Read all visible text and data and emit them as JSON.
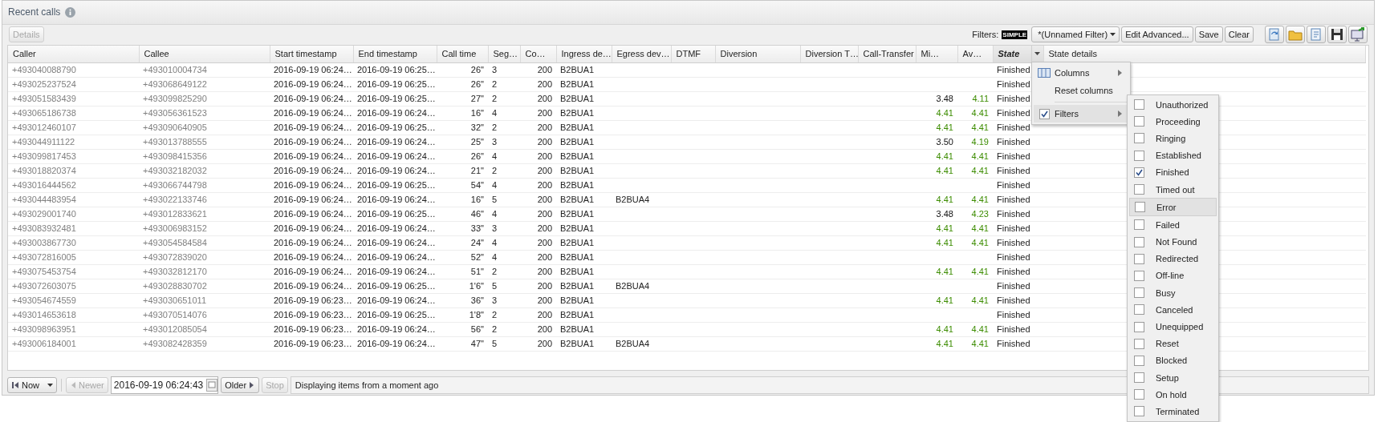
{
  "panel": {
    "title": "Recent calls"
  },
  "toolbar": {
    "details_button": {
      "label": "Details",
      "disabled": true
    },
    "filters_label": "Filters:",
    "mode_badge": "SIMPLE",
    "filter_select": "*(Unnamed Filter)",
    "buttons": [
      "Edit Advanced...",
      "Save",
      "Clear"
    ]
  },
  "table": {
    "columns": [
      {
        "label": "Caller",
        "filtered": false,
        "menu_open": false
      },
      {
        "label": "Callee",
        "filtered": false,
        "menu_open": false
      },
      {
        "label": "Start timestamp",
        "filtered": false,
        "menu_open": false
      },
      {
        "label": "End timestamp",
        "filtered": false,
        "menu_open": false
      },
      {
        "label": "Call time",
        "filtered": false,
        "menu_open": false
      },
      {
        "label": "Seg…",
        "filtered": false,
        "menu_open": false
      },
      {
        "label": "Co…",
        "filtered": false,
        "menu_open": false
      },
      {
        "label": "Ingress de…",
        "filtered": false,
        "menu_open": false
      },
      {
        "label": "Egress dev…",
        "filtered": false,
        "menu_open": false
      },
      {
        "label": "DTMF",
        "filtered": false,
        "menu_open": false
      },
      {
        "label": "Diversion",
        "filtered": false,
        "menu_open": false
      },
      {
        "label": "Diversion T…",
        "filtered": false,
        "menu_open": false
      },
      {
        "label": "Call-Transfer",
        "filtered": false,
        "menu_open": false
      },
      {
        "label": "Mi…",
        "filtered": false,
        "menu_open": false
      },
      {
        "label": "Av…",
        "filtered": false,
        "menu_open": false
      },
      {
        "label": "State",
        "filtered": true,
        "menu_open": true
      },
      {
        "label": "State details",
        "filtered": false,
        "menu_open": false
      }
    ],
    "rows": [
      {
        "caller": "+493040088790",
        "callee": "+493010004734",
        "start": "2016-09-19 06:24…",
        "end": "2016-09-19 06:25…",
        "call_time": "26\"",
        "segments": "3",
        "code": "200",
        "ingress": "B2BUA1",
        "state": "Finished"
      },
      {
        "caller": "+493025237524",
        "callee": "+493068649122",
        "start": "2016-09-19 06:24…",
        "end": "2016-09-19 06:25…",
        "call_time": "26\"",
        "segments": "2",
        "code": "200",
        "ingress": "B2BUA1",
        "state": "Finished"
      },
      {
        "caller": "+493051583439",
        "callee": "+493099825290",
        "start": "2016-09-19 06:24…",
        "end": "2016-09-19 06:25…",
        "call_time": "27\"",
        "segments": "2",
        "code": "200",
        "ingress": "B2BUA1",
        "mos_min": {
          "text": "3.48",
          "good": false
        },
        "mos_avg": {
          "text": "4.11",
          "good": true
        },
        "state": "Finished"
      },
      {
        "caller": "+493065186738",
        "callee": "+493056361523",
        "start": "2016-09-19 06:24…",
        "end": "2016-09-19 06:24…",
        "call_time": "16\"",
        "segments": "4",
        "code": "200",
        "ingress": "B2BUA1",
        "mos_min": {
          "text": "4.41",
          "good": true
        },
        "mos_avg": {
          "text": "4.41",
          "good": true
        },
        "state": "Finished"
      },
      {
        "caller": "+493012460107",
        "callee": "+493090640905",
        "start": "2016-09-19 06:24…",
        "end": "2016-09-19 06:25…",
        "call_time": "32\"",
        "segments": "2",
        "code": "200",
        "ingress": "B2BUA1",
        "mos_min": {
          "text": "4.41",
          "good": true
        },
        "mos_avg": {
          "text": "4.41",
          "good": true
        },
        "state": "Finished"
      },
      {
        "caller": "+493044911122",
        "callee": "+493013788555",
        "start": "2016-09-19 06:24…",
        "end": "2016-09-19 06:24…",
        "call_time": "25\"",
        "segments": "3",
        "code": "200",
        "ingress": "B2BUA1",
        "mos_min": {
          "text": "3.50",
          "good": false
        },
        "mos_avg": {
          "text": "4.19",
          "good": true
        },
        "state": "Finished"
      },
      {
        "caller": "+493099817453",
        "callee": "+493098415356",
        "start": "2016-09-19 06:24…",
        "end": "2016-09-19 06:24…",
        "call_time": "26\"",
        "segments": "4",
        "code": "200",
        "ingress": "B2BUA1",
        "mos_min": {
          "text": "4.41",
          "good": true
        },
        "mos_avg": {
          "text": "4.41",
          "good": true
        },
        "state": "Finished"
      },
      {
        "caller": "+493018820374",
        "callee": "+493032182032",
        "start": "2016-09-19 06:24…",
        "end": "2016-09-19 06:24…",
        "call_time": "21\"",
        "segments": "2",
        "code": "200",
        "ingress": "B2BUA1",
        "mos_min": {
          "text": "4.41",
          "good": true
        },
        "mos_avg": {
          "text": "4.41",
          "good": true
        },
        "state": "Finished"
      },
      {
        "caller": "+493016444562",
        "callee": "+493066744798",
        "start": "2016-09-19 06:24…",
        "end": "2016-09-19 06:25…",
        "call_time": "54\"",
        "segments": "4",
        "code": "200",
        "ingress": "B2BUA1",
        "state": "Finished"
      },
      {
        "caller": "+493044483954",
        "callee": "+493022133746",
        "start": "2016-09-19 06:24…",
        "end": "2016-09-19 06:24…",
        "call_time": "16\"",
        "segments": "5",
        "code": "200",
        "ingress": "B2BUA1",
        "egress": "B2BUA4",
        "mos_min": {
          "text": "4.41",
          "good": true
        },
        "mos_avg": {
          "text": "4.41",
          "good": true
        },
        "state": "Finished"
      },
      {
        "caller": "+493029001740",
        "callee": "+493012833621",
        "start": "2016-09-19 06:24…",
        "end": "2016-09-19 06:25…",
        "call_time": "46\"",
        "segments": "4",
        "code": "200",
        "ingress": "B2BUA1",
        "mos_min": {
          "text": "3.48",
          "good": false
        },
        "mos_avg": {
          "text": "4.23",
          "good": true
        },
        "state": "Finished"
      },
      {
        "caller": "+493083932481",
        "callee": "+493006983152",
        "start": "2016-09-19 06:24…",
        "end": "2016-09-19 06:24…",
        "call_time": "33\"",
        "segments": "3",
        "code": "200",
        "ingress": "B2BUA1",
        "mos_min": {
          "text": "4.41",
          "good": true
        },
        "mos_avg": {
          "text": "4.41",
          "good": true
        },
        "state": "Finished"
      },
      {
        "caller": "+493003867730",
        "callee": "+493054584584",
        "start": "2016-09-19 06:24…",
        "end": "2016-09-19 06:24…",
        "call_time": "24\"",
        "segments": "4",
        "code": "200",
        "ingress": "B2BUA1",
        "mos_min": {
          "text": "4.41",
          "good": true
        },
        "mos_avg": {
          "text": "4.41",
          "good": true
        },
        "state": "Finished"
      },
      {
        "caller": "+493072816005",
        "callee": "+493072839020",
        "start": "2016-09-19 06:24…",
        "end": "2016-09-19 06:24…",
        "call_time": "52\"",
        "segments": "4",
        "code": "200",
        "ingress": "B2BUA1",
        "state": "Finished"
      },
      {
        "caller": "+493075453754",
        "callee": "+493032812170",
        "start": "2016-09-19 06:24…",
        "end": "2016-09-19 06:24…",
        "call_time": "51\"",
        "segments": "2",
        "code": "200",
        "ingress": "B2BUA1",
        "mos_min": {
          "text": "4.41",
          "good": true
        },
        "mos_avg": {
          "text": "4.41",
          "good": true
        },
        "state": "Finished"
      },
      {
        "caller": "+493072603075",
        "callee": "+493028830702",
        "start": "2016-09-19 06:24…",
        "end": "2016-09-19 06:25…",
        "call_time": "1'6\"",
        "segments": "5",
        "code": "200",
        "ingress": "B2BUA1",
        "egress": "B2BUA4",
        "state": "Finished"
      },
      {
        "caller": "+493054674559",
        "callee": "+493030651011",
        "start": "2016-09-19 06:23…",
        "end": "2016-09-19 06:24…",
        "call_time": "36\"",
        "segments": "3",
        "code": "200",
        "ingress": "B2BUA1",
        "mos_min": {
          "text": "4.41",
          "good": true
        },
        "mos_avg": {
          "text": "4.41",
          "good": true
        },
        "state": "Finished"
      },
      {
        "caller": "+493014653618",
        "callee": "+493070514076",
        "start": "2016-09-19 06:23…",
        "end": "2016-09-19 06:25…",
        "call_time": "1'8\"",
        "segments": "2",
        "code": "200",
        "ingress": "B2BUA1",
        "state": "Finished"
      },
      {
        "caller": "+493098963951",
        "callee": "+493012085054",
        "start": "2016-09-19 06:23…",
        "end": "2016-09-19 06:24…",
        "call_time": "56\"",
        "segments": "2",
        "code": "200",
        "ingress": "B2BUA1",
        "mos_min": {
          "text": "4.41",
          "good": true
        },
        "mos_avg": {
          "text": "4.41",
          "good": true
        },
        "state": "Finished"
      },
      {
        "caller": "+493006184001",
        "callee": "+493082428359",
        "start": "2016-09-19 06:23…",
        "end": "2016-09-19 06:24…",
        "call_time": "47\"",
        "segments": "5",
        "code": "200",
        "ingress": "B2BUA1",
        "egress": "B2BUA4",
        "mos_min": {
          "text": "4.41",
          "good": true
        },
        "mos_avg": {
          "text": "4.41",
          "good": true
        },
        "state": "Finished"
      }
    ]
  },
  "column_menu": {
    "items": [
      {
        "label": "Columns",
        "kind": "icon",
        "submenu": true,
        "highlighted": false
      },
      {
        "label": "Reset columns",
        "kind": "plain",
        "submenu": false,
        "highlighted": false
      },
      {
        "label": "Filters",
        "kind": "check",
        "checked": true,
        "submenu": true,
        "highlighted": true
      }
    ]
  },
  "filter_menu": {
    "items": [
      {
        "label": "Unauthorized",
        "checked": false,
        "highlighted": false
      },
      {
        "label": "Proceeding",
        "checked": false,
        "highlighted": false
      },
      {
        "label": "Ringing",
        "checked": false,
        "highlighted": false
      },
      {
        "label": "Established",
        "checked": false,
        "highlighted": false
      },
      {
        "label": "Finished",
        "checked": true,
        "highlighted": false
      },
      {
        "label": "Timed out",
        "checked": false,
        "highlighted": false
      },
      {
        "label": "Error",
        "checked": false,
        "highlighted": true
      },
      {
        "label": "Failed",
        "checked": false,
        "highlighted": false
      },
      {
        "label": "Not Found",
        "checked": false,
        "highlighted": false
      },
      {
        "label": "Redirected",
        "checked": false,
        "highlighted": false
      },
      {
        "label": "Off-line",
        "checked": false,
        "highlighted": false
      },
      {
        "label": "Busy",
        "checked": false,
        "highlighted": false
      },
      {
        "label": "Canceled",
        "checked": false,
        "highlighted": false
      },
      {
        "label": "Unequipped",
        "checked": false,
        "highlighted": false
      },
      {
        "label": "Reset",
        "checked": false,
        "highlighted": false
      },
      {
        "label": "Blocked",
        "checked": false,
        "highlighted": false
      },
      {
        "label": "Setup",
        "checked": false,
        "highlighted": false
      },
      {
        "label": "On hold",
        "checked": false,
        "highlighted": false
      },
      {
        "label": "Terminated",
        "checked": false,
        "highlighted": false
      }
    ]
  },
  "paging": {
    "now_button": "Now",
    "newer_button": {
      "label": "Newer",
      "disabled": true
    },
    "date_value": "2016-09-19 06:24:43",
    "older_button": {
      "label": "Older",
      "disabled": false
    },
    "stop_button": {
      "label": "Stop",
      "disabled": true
    },
    "status": "Displaying items from a moment ago"
  }
}
